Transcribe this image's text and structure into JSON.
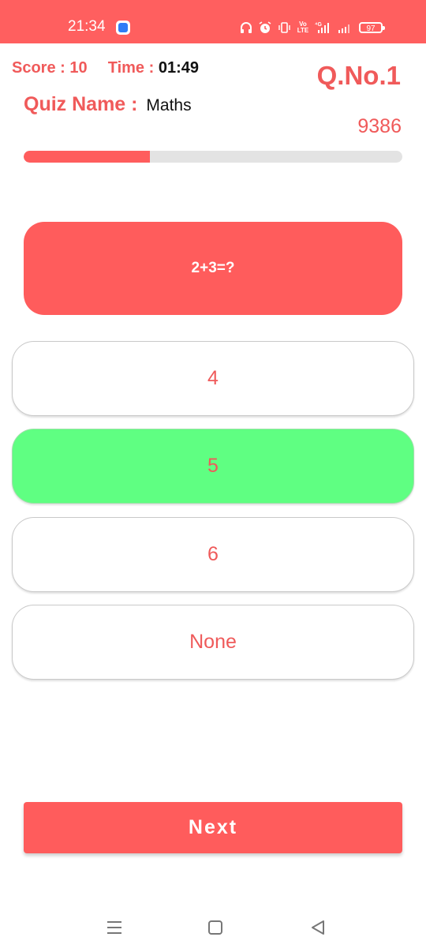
{
  "status_bar": {
    "time": "21:34",
    "battery": "97",
    "icons": [
      "app-notification-icon",
      "headphones-icon",
      "alarm-icon",
      "vibrate-icon",
      "volte-icon",
      "4g-signal-icon",
      "signal-icon",
      "battery-icon"
    ],
    "volte_text": "Vo LTE"
  },
  "header": {
    "score_label": "Score : ",
    "score_value": "10",
    "time_label": "Time : ",
    "time_value": "01:49",
    "question_number": "Q.No.1",
    "quiz_name_label": "Quiz Name : ",
    "quiz_name_value": "Maths",
    "question_id": "9386"
  },
  "progress": {
    "fraction": 0.333
  },
  "question": {
    "text": "2+3=?"
  },
  "options": [
    {
      "label": "4",
      "selected": false
    },
    {
      "label": "5",
      "selected": true
    },
    {
      "label": "6",
      "selected": false
    },
    {
      "label": "None",
      "selected": false
    }
  ],
  "next_button": {
    "label": "Next"
  },
  "nav_bar": {
    "icons": [
      "menu-icon",
      "home-icon",
      "back-icon"
    ]
  },
  "colors": {
    "accent": "#ff5c5c",
    "accent_text": "#f05a5a",
    "selected_option": "#5fff82",
    "progress_track": "#e3e3e3"
  }
}
